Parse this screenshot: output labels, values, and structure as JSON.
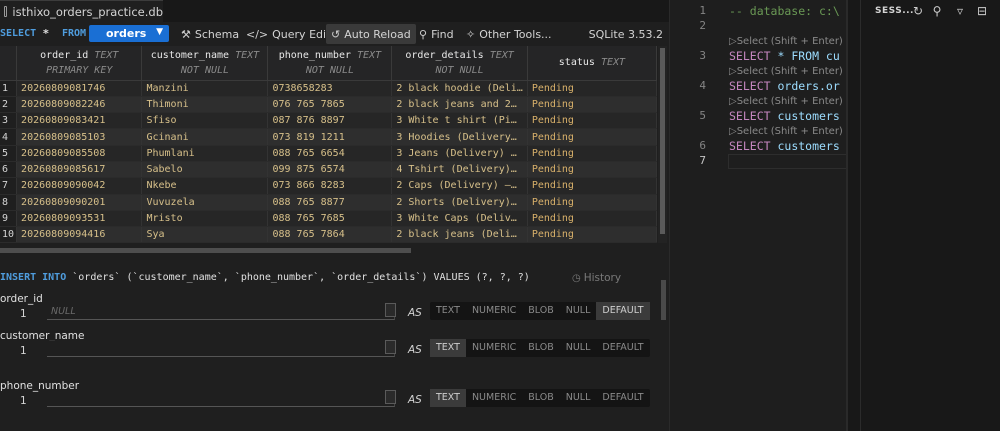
{
  "tab": {
    "title": "isthixo_orders_practice.db",
    "icon": "database-file-icon"
  },
  "toolbar": {
    "select_kw": "SELECT",
    "star": "*",
    "from_kw": "FROM",
    "table": "orders",
    "schema_label": "Schema",
    "query_editor_label": "Query Editor",
    "auto_reload_label": "Auto Reload",
    "find_label": "Find",
    "other_tools_label": "Other Tools...",
    "sqlite_version": "SQLite 3.53.2",
    "accent_color": "#1a6fd4"
  },
  "grid": {
    "columns": [
      {
        "name": "order_id",
        "type": "TEXT PRIMARY KEY"
      },
      {
        "name": "customer_name",
        "type": "TEXT NOT NULL"
      },
      {
        "name": "phone_number",
        "type": "TEXT NOT NULL"
      },
      {
        "name": "order_details",
        "type": "TEXT NOT NULL"
      },
      {
        "name": "status",
        "type": "TEXT"
      }
    ],
    "rows": [
      [
        "1",
        "20260809081746",
        "Manzini",
        "0738658283",
        "2 black hoodie (Deli…",
        "Pending"
      ],
      [
        "2",
        "20260809082246",
        "Thimoni",
        "076 765 7865",
        "2 black jeans and 2…",
        "Pending"
      ],
      [
        "3",
        "20260809083421",
        "Sfiso",
        "087 876 8897",
        "3 White t shirt (Pi…",
        "Pending"
      ],
      [
        "4",
        "20260809085103",
        "Gcinani",
        "073 819 1211",
        "3 Hoodies (Delivery…",
        "Pending"
      ],
      [
        "5",
        "20260809085508",
        "Phumlani",
        "088 765 6654",
        "3 Jeans (Delivery) …",
        "Pending"
      ],
      [
        "6",
        "20260809085617",
        "Sabelo",
        "099 875 6574",
        "4 Tshirt (Delivery)…",
        "Pending"
      ],
      [
        "7",
        "20260809090042",
        "Nkebe",
        "073 866 8283",
        "2 Caps (Delivery) –…",
        "Pending"
      ],
      [
        "8",
        "20260809090201",
        "Vuvuzela",
        "088 765 8877",
        "2 Shorts (Delivery)…",
        "Pending"
      ],
      [
        "9",
        "20260809093531",
        "Mristo",
        "088 765 7685",
        "3 White Caps (Deliv…",
        "Pending"
      ],
      [
        "10",
        "20260809094416",
        "Sya",
        "088 765 7864",
        "2 black jeans (Deli…",
        "Pending"
      ]
    ]
  },
  "insert": {
    "kw": "INSERT INTO",
    "rest": " `orders` (`customer_name`, `phone_number`, `order_details`) VALUES (?, ?, ?)",
    "history_label": "History",
    "as_label": "AS",
    "types": [
      "TEXT",
      "NUMERIC",
      "BLOB",
      "NULL",
      "DEFAULT"
    ],
    "fields": [
      {
        "name": "order_id",
        "num": "1",
        "placeholder": "NULL",
        "selected": "DEFAULT"
      },
      {
        "name": "customer_name",
        "num": "1",
        "placeholder": "",
        "selected": "TEXT"
      },
      {
        "name": "phone_number",
        "num": "1",
        "placeholder": "",
        "selected": "TEXT"
      }
    ]
  },
  "editor": {
    "lines": [
      {
        "n": "1",
        "comment": "-- database: c:\\"
      },
      {
        "n": "2",
        "lens": "▷Select (Shift + Enter)",
        "k": "SELECT",
        "rest": " * FROM cu"
      },
      {
        "n": "3",
        "lens": "▷Select (Shift + Enter)",
        "k": "SELECT",
        "rest": " orders.or"
      },
      {
        "n": "4",
        "lens": "▷Select (Shift + Enter)",
        "k": "SELECT",
        "rest": " customers"
      },
      {
        "n": "5",
        "lens": "▷Select (Shift + Enter)",
        "k": "SELECT",
        "rest": " customers"
      },
      {
        "n": "6"
      },
      {
        "n": "7"
      }
    ]
  },
  "sessions": {
    "title": "SESS..."
  }
}
